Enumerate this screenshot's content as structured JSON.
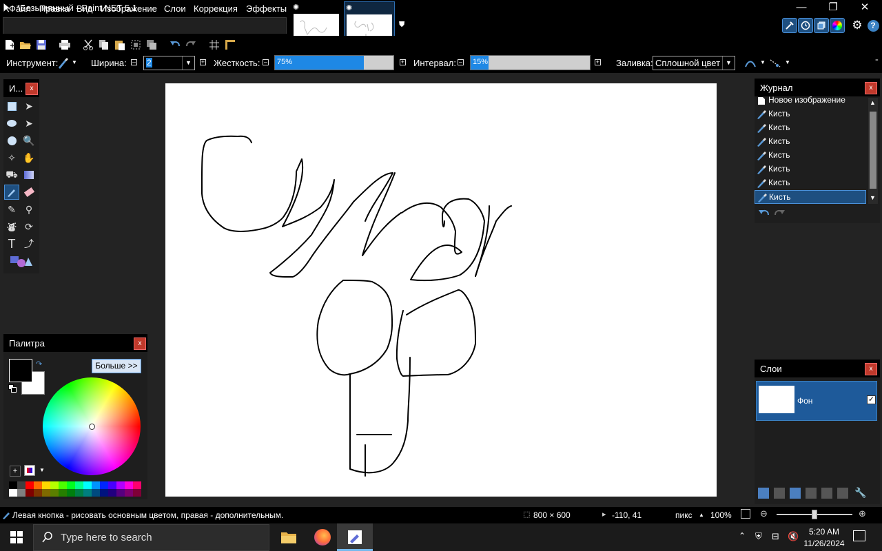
{
  "window": {
    "title": "*Безымянный - Paint.NET 5.1",
    "minimize": "—",
    "restore": "❐",
    "close": "✕"
  },
  "menu": [
    "Файл",
    "Правка",
    "Вид",
    "Изображение",
    "Слои",
    "Коррекция",
    "Эффекты"
  ],
  "toolbar2": {
    "tool_label": "Инструмент:",
    "width_label": "Ширина:",
    "width_value": "2",
    "hardness_label": "Жесткость:",
    "hardness_value": "75%",
    "hardness_fraction": 0.75,
    "interval_label": "Интервал:",
    "interval_value": "15%",
    "interval_fraction": 0.15,
    "fill_label": "Заливка:",
    "fill_value": "Сплошной цвет"
  },
  "tools_panel": {
    "title": "И...",
    "close": "x"
  },
  "palette_panel": {
    "title": "Палитра",
    "close": "x",
    "more_button": "Больше >>",
    "primary_color": "#000000",
    "secondary_color": "#ffffff",
    "swatches_row1": [
      "#000000",
      "#404040",
      "#ff0000",
      "#ff6a00",
      "#ffd800",
      "#b6ff00",
      "#4cff00",
      "#00ff21",
      "#00ff90",
      "#00ffff",
      "#0094ff",
      "#0026ff",
      "#4800ff",
      "#b200ff",
      "#ff00dc",
      "#ff006e"
    ],
    "swatches_row2": [
      "#ffffff",
      "#808080",
      "#7f0000",
      "#7f3300",
      "#7f6a00",
      "#5b7f00",
      "#267f00",
      "#007f0e",
      "#007f46",
      "#007f7f",
      "#004a7f",
      "#00137f",
      "#21007f",
      "#57007f",
      "#7f006e",
      "#7f0037"
    ]
  },
  "history_panel": {
    "title": "Журнал",
    "close": "x",
    "items": [
      "Новое изображение",
      "Кисть",
      "Кисть",
      "Кисть",
      "Кисть",
      "Кисть",
      "Кисть",
      "Кисть"
    ],
    "selected_index": 7
  },
  "layers_panel": {
    "title": "Слои",
    "close": "x",
    "layer_name": "Фон",
    "layer_visible": true
  },
  "status": {
    "hint": "Левая кнопка - рисовать основным цветом, правая - дополнительным.",
    "image_size": "800 × 600",
    "cursor_pos": "-110, 41",
    "units": "пикс",
    "zoom": "100%",
    "zoom_slider_fraction": 0.5
  },
  "taskbar": {
    "search_placeholder": "Type here to search",
    "time": "5:20 AM",
    "date": "11/26/2024"
  },
  "colors": {
    "accent": "#1e88e5",
    "selection": "#1e4f80",
    "close_red": "#c0392b"
  }
}
